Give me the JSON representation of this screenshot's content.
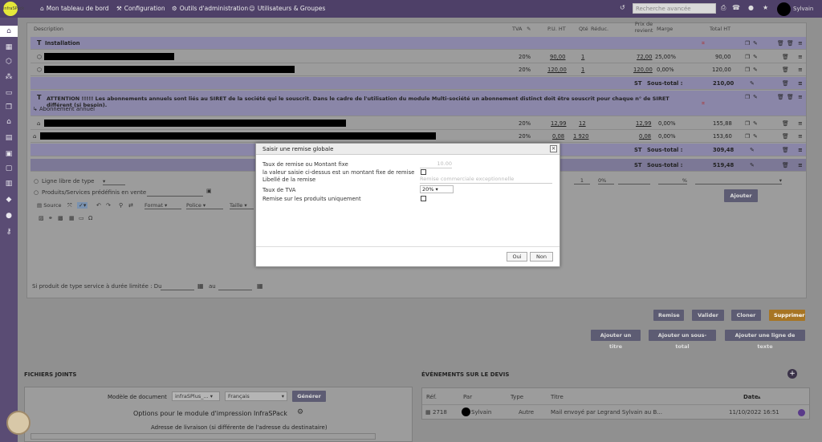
{
  "topbar": {
    "logo": "infraSPack",
    "menu": [
      "Mon tableau de bord",
      "Configuration",
      "Outils d'administration",
      "Utilisateurs & Groupes"
    ],
    "search_placeholder": "Recherche avancée",
    "user": "Sylvain"
  },
  "table": {
    "headers": {
      "description": "Description",
      "tva": "TVA",
      "pu_ht": "P.U. HT",
      "qty": "Qté",
      "reduc": "Réduc.",
      "prix_revient": "Prix de revient",
      "marge": "Marge",
      "total_ht": "Total HT"
    },
    "rows": [
      {
        "kind": "title",
        "label": "Installation"
      },
      {
        "kind": "line",
        "tva": "20%",
        "pu": "90,00",
        "qty": "1",
        "reduc": "",
        "prix": "72,00",
        "marge": "25,00%",
        "total": "90,00"
      },
      {
        "kind": "line",
        "tva": "20%",
        "pu": "120,00",
        "qty": "1",
        "reduc": "",
        "prix": "120,00",
        "marge": "0,00%",
        "total": "120,00"
      },
      {
        "kind": "subtotal",
        "label": "Sous-total :",
        "total": "210,00"
      },
      {
        "kind": "note",
        "text": "ATTENTION !!!!! Les abonnements annuels sont liés au SIRET de la société qui le souscrit. Dans le cadre de l'utilisation du module Multi-société un abonnement distinct doit être souscrit pour chaque n° de SIRET différent (si besoin).",
        "sub": "Abonnement annuel"
      },
      {
        "kind": "line",
        "tva": "20%",
        "pu": "12,99",
        "qty": "12",
        "reduc": "",
        "prix": "12,99",
        "marge": "0,00%",
        "total": "155,88"
      },
      {
        "kind": "line",
        "tva": "20%",
        "pu": "0,08",
        "qty": "1 920",
        "reduc": "",
        "prix": "0,08",
        "marge": "0,00%",
        "total": "153,60"
      },
      {
        "kind": "subtotal",
        "label": "Sous-total :",
        "total": "309,48"
      },
      {
        "kind": "subtotal",
        "label": "Sous-total :",
        "total": "519,48"
      }
    ]
  },
  "addline": {
    "free_line": "Ligne libre de type",
    "predefined": "Produits/Services prédéfinis en vente",
    "editor": [
      "Source",
      "Format",
      "Police",
      "Taille"
    ],
    "qty": "1",
    "reduc": "0%",
    "percent": "%",
    "add_button": "Ajouter",
    "period_label": "Si produit de type service à durée limitée : Du",
    "period_to": "au"
  },
  "dialog": {
    "title": "Saisir une remise globale",
    "amount_label": "Taux de remise ou Montant fixe",
    "amount_placeholder": "10.00",
    "fixed_label": "la valeur saisie ci-dessus est un montant fixe de remise",
    "libelle_label": "Libellé de la remise",
    "libelle_placeholder": "Remise commerciale exceptionnelle",
    "tva_label": "Taux de TVA",
    "tva_value": "20%",
    "products_only_label": "Remise sur les produits uniquement",
    "yes": "Oui",
    "no": "Non"
  },
  "actions": {
    "remise": "Remise",
    "valider": "Valider",
    "cloner": "Cloner",
    "supprimer": "Supprimer",
    "ajouter_titre": "Ajouter un titre",
    "ajouter_sous_total": "Ajouter un sous-total",
    "ajouter_ligne_texte": "Ajouter une ligne de texte"
  },
  "files": {
    "title": "FICHIERS JOINTS",
    "model_label": "Modèle de document",
    "model_value": "infraSPlus_...",
    "lang_value": "Français",
    "generate": "Générer",
    "options_title": "Options pour le module d'impression InfraSPack",
    "address_label": "Adresse de livraison (si différente de l'adresse du destinataire)"
  },
  "events": {
    "title": "ÉVÉNEMENTS SUR LE DEVIS",
    "headers": {
      "ref": "Réf.",
      "par": "Par",
      "type": "Type",
      "titre": "Titre",
      "date": "Date"
    },
    "row": {
      "ref": "2718",
      "par": "Sylvain",
      "type": "Autre",
      "titre": "Mail envoyé par Legrand Sylvain au B...",
      "date": "11/10/2022 16:51"
    }
  },
  "colors": {
    "topbar": "#4e4068",
    "sidebar": "#5a4c74",
    "title_row": "#8a86a8",
    "button": "#5d5c73",
    "danger": "#a77524"
  }
}
